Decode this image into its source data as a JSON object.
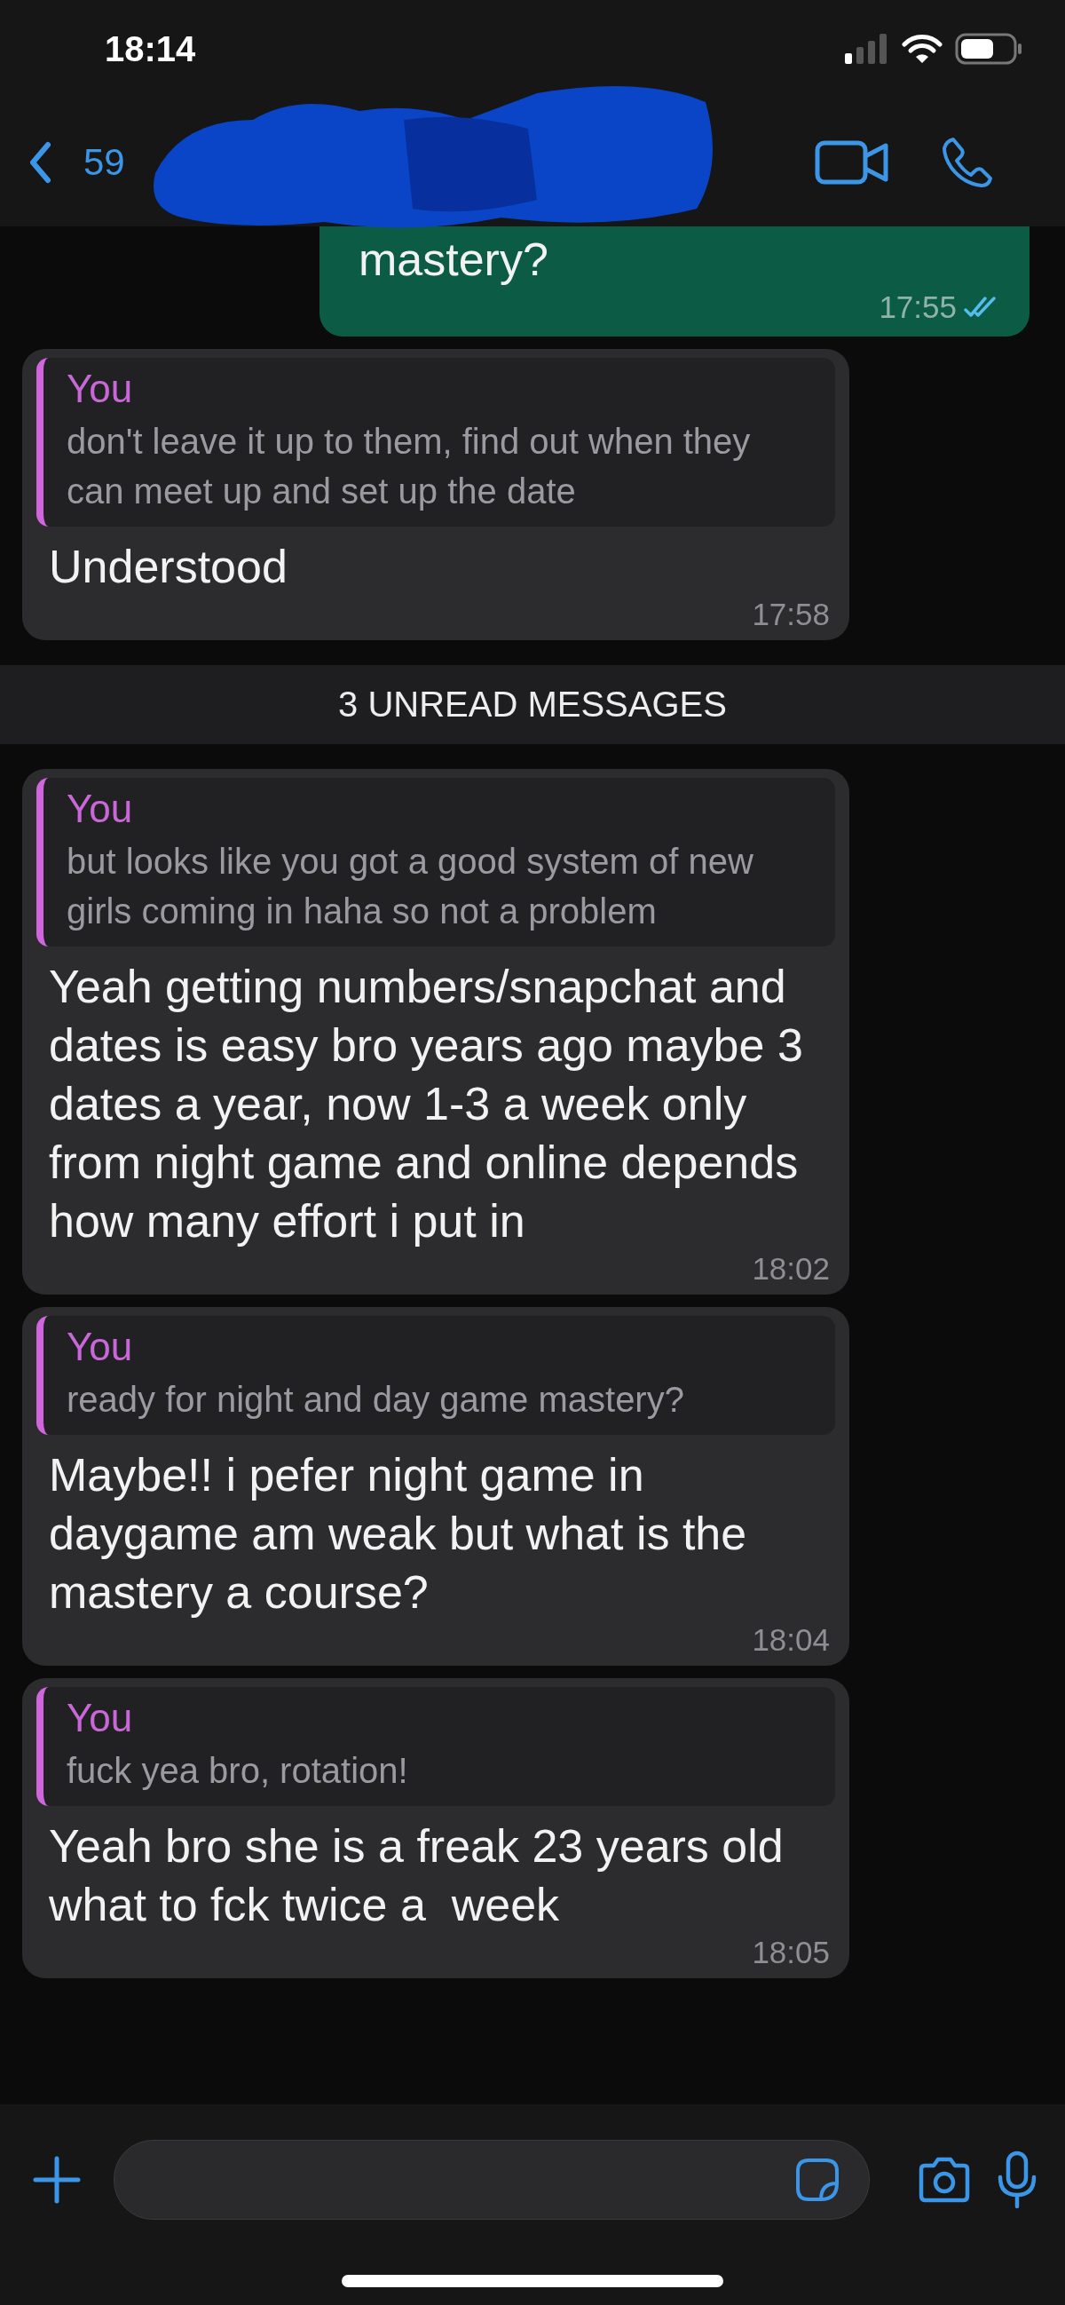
{
  "status_bar": {
    "time": "18:14"
  },
  "header": {
    "back_label": "59"
  },
  "messages": [
    {
      "kind": "outgoing",
      "text": "mastery?",
      "time": "17:55",
      "read": true
    },
    {
      "kind": "incoming",
      "quote": {
        "author": "You",
        "text": "don't leave it up to them, find out when they can meet up and set up the date"
      },
      "text": "Understood",
      "time": "17:58"
    },
    {
      "kind": "divider",
      "text": "3 UNREAD MESSAGES"
    },
    {
      "kind": "incoming",
      "quote": {
        "author": "You",
        "text": "but looks like you got a good system of new girls coming in haha so not a problem"
      },
      "text": "Yeah getting numbers/snapchat and dates is easy bro years ago maybe 3 dates a year, now 1-3 a week only from night game and online depends how many effort i put in",
      "time": "18:02"
    },
    {
      "kind": "incoming",
      "quote": {
        "author": "You",
        "text": "ready for night and day game mastery?"
      },
      "text": "Maybe!! i pefer night game in daygame am weak but what is the mastery a course?",
      "time": "18:04"
    },
    {
      "kind": "incoming",
      "quote": {
        "author": "You",
        "text": "fuck yea bro, rotation!"
      },
      "text": "Yeah bro she is a freak 23 years old what to fck twice a  week",
      "time": "18:05"
    }
  ]
}
